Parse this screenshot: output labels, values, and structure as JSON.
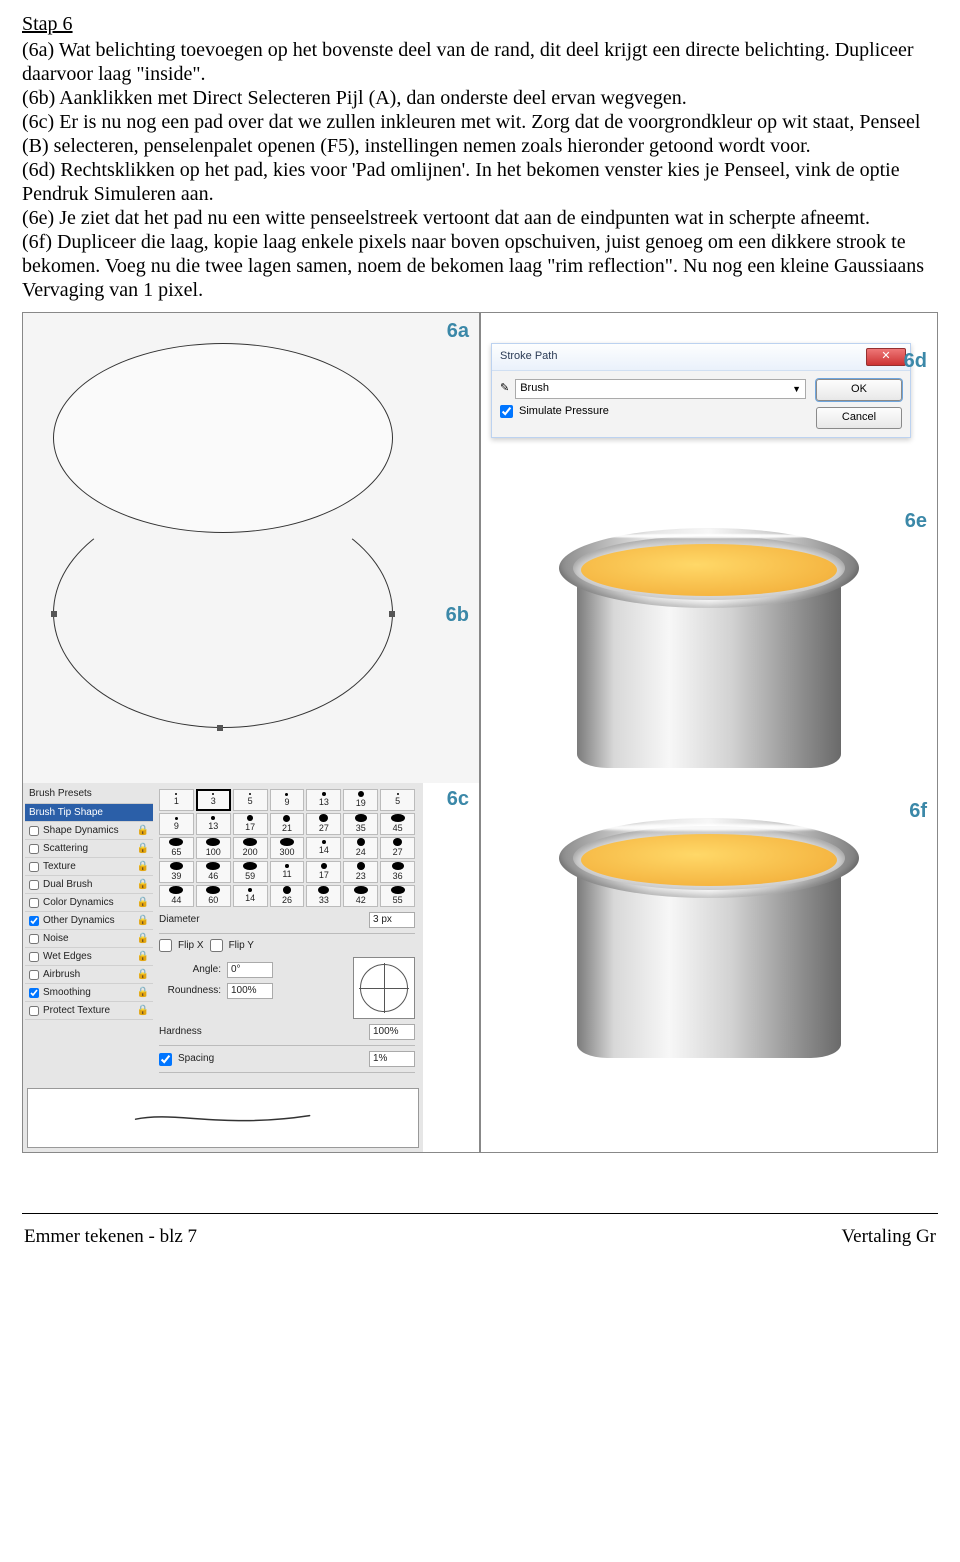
{
  "step_title": "Stap 6",
  "p6a": "(6a) Wat belichting toevoegen op het bovenste deel van de rand, dit deel krijgt een directe belichting. Dupliceer daarvoor laag \"inside\".",
  "p6b": "(6b) Aanklikken met Direct Selecteren Pijl (A), dan onderste deel ervan wegvegen.",
  "p6c": "(6c) Er is nu nog een pad over dat we zullen inkleuren met wit. Zorg dat de voorgrondkleur op wit staat, Penseel (B) selecteren, penselenpalet openen (F5), instellingen nemen zoals hieronder getoond wordt voor.",
  "p6d": "(6d) Rechtsklikken op het pad, kies voor 'Pad omlijnen'. In het bekomen venster kies je Penseel, vink de optie Pendruk Simuleren aan.",
  "p6e": "(6e) Je ziet dat het pad nu een witte penseelstreek vertoont dat aan de eindpunten wat in scherpte afneemt.",
  "p6f": "(6f) Dupliceer die laag, kopie laag enkele pixels naar boven opschuiven, juist genoeg om een dikkere strook te bekomen. Voeg nu die twee lagen samen, noem de bekomen laag \"rim reflection\". Nu nog een kleine Gaussiaans Vervaging van 1 pixel.",
  "labels": {
    "a": "6a",
    "b": "6b",
    "c": "6c",
    "d": "6d",
    "e": "6e",
    "f": "6f"
  },
  "brush_panel": {
    "header": "Brush Presets",
    "active": "Brush Tip Shape",
    "options": [
      "Shape Dynamics",
      "Scattering",
      "Texture",
      "Dual Brush",
      "Color Dynamics",
      "Other Dynamics",
      "Noise",
      "Wet Edges",
      "Airbrush",
      "Smoothing",
      "Protect Texture"
    ],
    "checked": [
      "Other Dynamics",
      "Smoothing"
    ],
    "thumb_rows": [
      [
        "1",
        "3",
        "5",
        "9",
        "13",
        "19",
        "5"
      ],
      [
        "9",
        "13",
        "17",
        "21",
        "27",
        "35",
        "45"
      ],
      [
        "65",
        "100",
        "200",
        "300",
        "14",
        "24",
        "27"
      ],
      [
        "39",
        "46",
        "59",
        "11",
        "17",
        "23",
        "36"
      ],
      [
        "44",
        "60",
        "14",
        "26",
        "33",
        "42",
        "55"
      ]
    ],
    "selected_thumb": "3",
    "diameter_label": "Diameter",
    "diameter_value": "3 px",
    "flipx": "Flip X",
    "flipy": "Flip Y",
    "angle_label": "Angle:",
    "angle_value": "0°",
    "roundness_label": "Roundness:",
    "roundness_value": "100%",
    "hardness_label": "Hardness",
    "hardness_value": "100%",
    "spacing_label": "Spacing",
    "spacing_value": "1%"
  },
  "stroke_dialog": {
    "title": "Stroke Path",
    "tool": "Brush",
    "simulate": "Simulate Pressure",
    "ok": "OK",
    "cancel": "Cancel"
  },
  "footer_left": "Emmer tekenen - blz 7",
  "footer_right": "Vertaling Gr"
}
